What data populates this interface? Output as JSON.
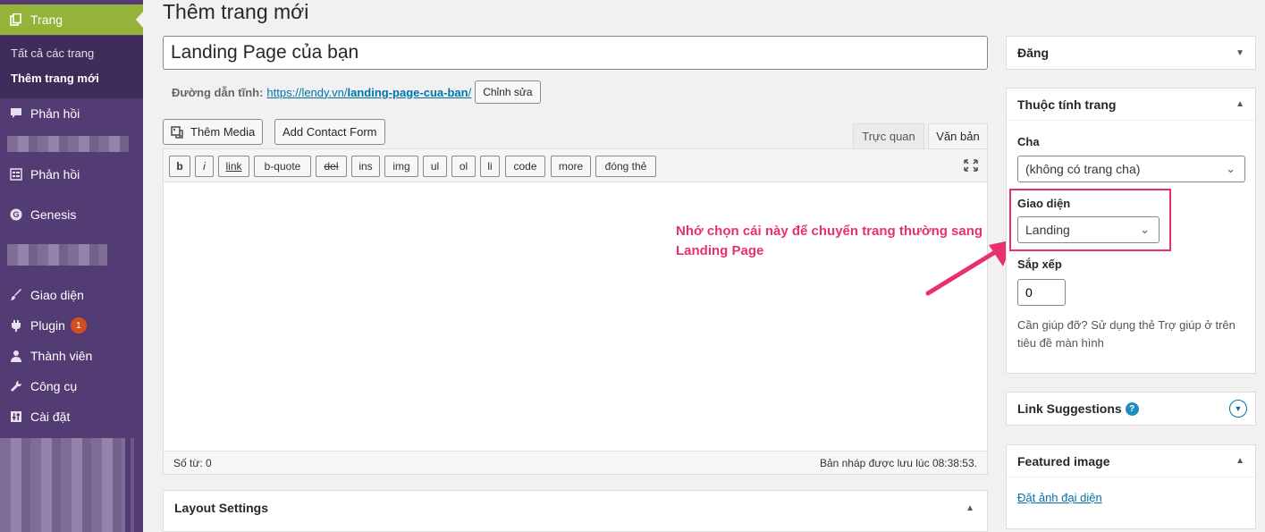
{
  "sidebar": {
    "active": {
      "label": "Trang",
      "icon": "pages-icon"
    },
    "submenu": [
      "Tất cả các trang",
      "Thêm trang mới"
    ],
    "items": [
      {
        "label": "Phản hồi",
        "icon": "comment-bubble-icon"
      },
      {
        "label": "Phản hồi",
        "icon": "form-icon"
      },
      {
        "label": "Genesis",
        "icon": "genesis-icon"
      },
      {
        "label": "Giao diện",
        "icon": "brush-icon"
      },
      {
        "label": "Plugin",
        "icon": "plugin-icon",
        "badge": "1"
      },
      {
        "label": "Thành viên",
        "icon": "user-icon"
      },
      {
        "label": "Công cụ",
        "icon": "wrench-icon"
      },
      {
        "label": "Cài đặt",
        "icon": "sliders-icon"
      }
    ]
  },
  "main": {
    "page_title": "Thêm trang mới",
    "title_value": "Landing Page của bạn",
    "permalink": {
      "label": "Đường dẫn tĩnh:",
      "base": "https://lendy.vn/",
      "slug": "landing-page-cua-ban",
      "trail": "/",
      "edit_button": "Chỉnh sửa"
    },
    "add_media": "Thêm Media",
    "add_contact_form": "Add Contact Form",
    "tabs": [
      "Trực quan",
      "Văn bản"
    ],
    "quicktags": [
      "b",
      "i",
      "link",
      "b-quote",
      "del",
      "ins",
      "img",
      "ul",
      "ol",
      "li",
      "code",
      "more",
      "đóng thẻ"
    ],
    "word_count": "Số từ: 0",
    "draft_status": "Bản nháp được lưu lúc 08:38:53.",
    "layout_settings": "Layout Settings",
    "annotation": [
      "Nhớ chọn cái này để chuyển trang thường sang",
      "Landing Page"
    ],
    "annotation_color": "#e8306d"
  },
  "side": {
    "publish": {
      "title": "Đăng"
    },
    "attributes": {
      "title": "Thuộc tính trang",
      "parent_label": "Cha",
      "parent_value": "(không có trang cha)",
      "template_label": "Giao diện",
      "template_value": "Landing",
      "order_label": "Sắp xếp",
      "order_value": "0",
      "help": "Cần giúp đỡ? Sử dụng thẻ Trợ giúp ở trên tiêu đề màn hình"
    },
    "link_suggestions": {
      "title": "Link Suggestions"
    },
    "featured_image": {
      "title": "Featured image",
      "link": "Đặt ảnh đại diện"
    }
  },
  "colors": {
    "sidebar": "#533b74",
    "active": "#96b339",
    "link": "#0073aa"
  }
}
